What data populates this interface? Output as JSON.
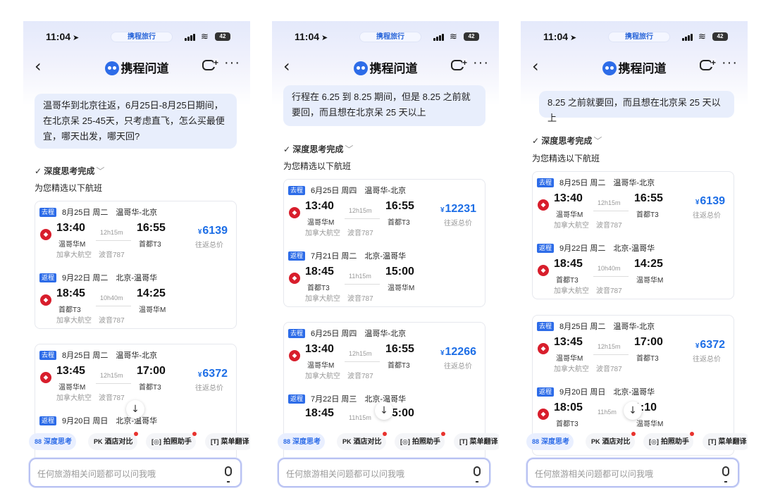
{
  "common": {
    "time": "11:04",
    "brand": "携程旅行",
    "battery": "42",
    "nav_title": "携程问道",
    "think_label": "深度思考完成",
    "intro": "为您精选以下航班",
    "chips": [
      {
        "label": "深度思考",
        "icon": "88",
        "active": true,
        "dot": false
      },
      {
        "label": "酒店对比",
        "icon": "PK",
        "active": false,
        "dot": true
      },
      {
        "label": "拍照助手",
        "icon": "[◎]",
        "active": false,
        "dot": true
      },
      {
        "label": "菜单翻译",
        "icon": "[T]",
        "active": false,
        "dot": false
      }
    ],
    "input_placeholder": "任何旅游相关问题都可以问我哦",
    "total_label": "往返总价",
    "currency": "¥"
  },
  "panels": [
    {
      "question": "温哥华到北京往返，6月25日-8月25日期间，在北京呆 25-45天，只考虑直飞，怎么买最便宜，哪天出发，哪天回?",
      "cards": [
        {
          "price": "6139",
          "out": {
            "tag": "去程",
            "route": "8月25日 周二　温哥华-北京",
            "dep": "13:40",
            "dep_apt": "温哥华M",
            "dur": "12h15m",
            "arr": "16:55",
            "arr_apt": "首都T3",
            "airline": "加拿大航空　波音787"
          },
          "ret": {
            "tag": "返程",
            "route": "9月22日 周二　北京-温哥华",
            "dep": "18:45",
            "dep_apt": "首都T3",
            "dur": "10h40m",
            "arr": "14:25",
            "arr_apt": "温哥华M",
            "airline": "加拿大航空　波音787"
          }
        },
        {
          "price": "6372",
          "out": {
            "tag": "去程",
            "route": "8月25日 周二　温哥华-北京",
            "dep": "13:45",
            "dep_apt": "温哥华M",
            "dur": "12h15m",
            "arr": "17:00",
            "arr_apt": "首都T3",
            "airline": "加拿大航空　波音787"
          },
          "ret": {
            "tag": "返程",
            "route": "9月20日 周日　北京-温哥华"
          }
        }
      ]
    },
    {
      "question": "行程在 6.25 到 8.25 期间，但是 8.25 之前就要回，而且想在北京呆 25 天以上",
      "cards": [
        {
          "price": "12231",
          "out": {
            "tag": "去程",
            "route": "6月25日 周四　温哥华-北京",
            "dep": "13:40",
            "dep_apt": "温哥华M",
            "dur": "12h15m",
            "arr": "16:55",
            "arr_apt": "首都T3",
            "airline": "加拿大航空　波音787"
          },
          "ret": {
            "tag": "返程",
            "route": "7月21日 周二　北京-温哥华",
            "dep": "18:45",
            "dep_apt": "首都T3",
            "dur": "11h15m",
            "arr": "15:00",
            "arr_apt": "温哥华M",
            "airline": "加拿大航空　波音787"
          }
        },
        {
          "price": "12266",
          "out": {
            "tag": "去程",
            "route": "6月25日 周四　温哥华-北京",
            "dep": "13:40",
            "dep_apt": "温哥华M",
            "dur": "12h15m",
            "arr": "16:55",
            "arr_apt": "首都T3",
            "airline": "加拿大航空　波音787"
          },
          "ret": {
            "tag": "返程",
            "route": "7月22日 周三　北京-温哥华",
            "dep": "18:45",
            "dur": "11h15m",
            "arr": "15:00"
          }
        }
      ]
    },
    {
      "question": "8.25 之前就要回，而且想在北京呆 25 天以上",
      "cards": [
        {
          "price": "6139",
          "out": {
            "tag": "去程",
            "route": "8月25日 周二　温哥华-北京",
            "dep": "13:40",
            "dep_apt": "温哥华M",
            "dur": "12h15m",
            "arr": "16:55",
            "arr_apt": "首都T3",
            "airline": "加拿大航空　波音787"
          },
          "ret": {
            "tag": "返程",
            "route": "9月22日 周二　北京-温哥华",
            "dep": "18:45",
            "dep_apt": "首都T3",
            "dur": "10h40m",
            "arr": "14:25",
            "arr_apt": "温哥华M",
            "airline": "加拿大航空　波音787"
          }
        },
        {
          "price": "6372",
          "out": {
            "tag": "去程",
            "route": "8月25日 周二　温哥华-北京",
            "dep": "13:45",
            "dep_apt": "温哥华M",
            "dur": "12h15m",
            "arr": "17:00",
            "arr_apt": "首都T3",
            "airline": "加拿大航空　波音787"
          },
          "ret": {
            "tag": "返程",
            "route": "9月20日 周日　北京-温哥华",
            "dep": "18:05",
            "dep_apt": "首都T3",
            "dur": "11h5m",
            "arr": "1:10",
            "arr_apt": "温哥华M"
          }
        }
      ]
    }
  ]
}
